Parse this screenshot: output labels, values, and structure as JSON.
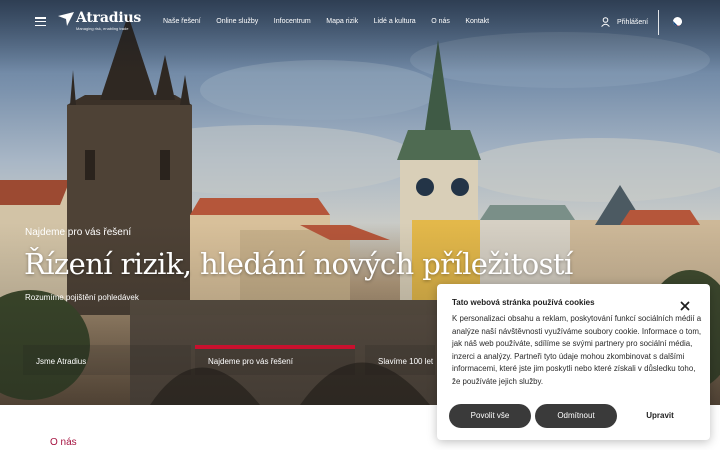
{
  "brand": {
    "name": "Atradius",
    "tagline": "Managing risk, enabling trade"
  },
  "nav": {
    "items": [
      "Naše řešení",
      "Online služby",
      "Infocentrum",
      "Mapa rizik",
      "Lidé a kultura",
      "O nás",
      "Kontakt"
    ],
    "login_label": "Přihlášení",
    "language": "Czech flag"
  },
  "hero": {
    "tagline": "Najdeme pro vás řešení",
    "title": "Řízení rizik, hledání nových příležitostí",
    "subtitle": "Rozumíme pojištění pohledávek"
  },
  "slider": {
    "tabs": [
      {
        "label": "Jsme Atradius",
        "active": false
      },
      {
        "label": "Najdeme pro vás řešení",
        "active": true
      },
      {
        "label": "Slavíme 100 let",
        "active": false
      }
    ],
    "active_color": "#c8102e"
  },
  "section": {
    "label": "O nás"
  },
  "cookie": {
    "title": "Tato webová stránka používá cookies",
    "body": "K personalizaci obsahu a reklam, poskytování funkcí sociálních médií a analýze naší návštěvnosti využíváme soubory cookie. Informace o tom, jak náš web používáte, sdílíme se svými partnery pro sociální média, inzerci a analýzy. Partneři tyto údaje mohou zkombinovat s dalšími informacemi, které jste jim poskytli nebo které získali v důsledku toho, že používáte jejich služby.",
    "allow_label": "Povolit vše",
    "reject_label": "Odmítnout",
    "edit_label": "Upravit"
  },
  "colors": {
    "accent": "#c8102e",
    "section_label": "#a5113f",
    "button_dark": "#3a3a3a"
  }
}
